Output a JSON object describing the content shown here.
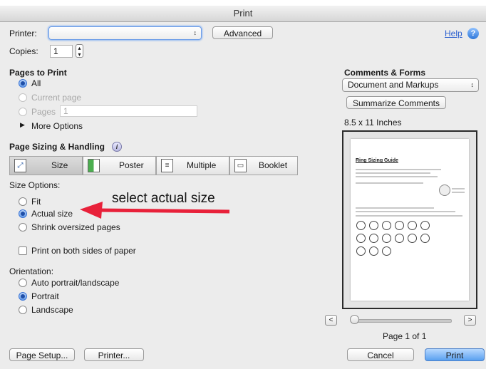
{
  "window": {
    "title": "Print"
  },
  "printer": {
    "label": "Printer:",
    "value": "",
    "advanced_label": "Advanced",
    "help_label": "Help"
  },
  "copies": {
    "label": "Copies:",
    "value": "1"
  },
  "pages_to_print": {
    "heading": "Pages to Print",
    "all": "All",
    "current_page": "Current page",
    "pages": "Pages",
    "pages_value": "1",
    "more_options": "More Options",
    "selected": "All"
  },
  "sizing": {
    "heading": "Page Sizing & Handling",
    "modes": [
      "Size",
      "Poster",
      "Multiple",
      "Booklet"
    ],
    "selected_mode": "Size",
    "options_label": "Size Options:",
    "options": [
      "Fit",
      "Actual size",
      "Shrink oversized pages"
    ],
    "selected_option": "Actual size"
  },
  "annotation": {
    "text": "select actual size",
    "arrow_color": "#e8213a"
  },
  "duplex": {
    "label": "Print on both sides of paper",
    "checked": false
  },
  "orientation": {
    "label": "Orientation:",
    "options": [
      "Auto portrait/landscape",
      "Portrait",
      "Landscape"
    ],
    "selected": "Portrait"
  },
  "comments_forms": {
    "heading": "Comments & Forms",
    "value": "Document and Markups",
    "summarize_label": "Summarize Comments"
  },
  "preview": {
    "paper_size": "8.5 x 11 Inches",
    "page_indicator": "Page 1 of 1",
    "doc_title": "Ring Sizing Guide",
    "prev_label": "<",
    "next_label": ">",
    "ring_rows": [
      6,
      6,
      3
    ]
  },
  "footer": {
    "page_setup_label": "Page Setup...",
    "printer_label": "Printer...",
    "cancel_label": "Cancel",
    "print_label": "Print"
  },
  "colors": {
    "accent": "#3a74d6",
    "print_button": "#5aa0f0",
    "link": "#2a5fcf"
  }
}
